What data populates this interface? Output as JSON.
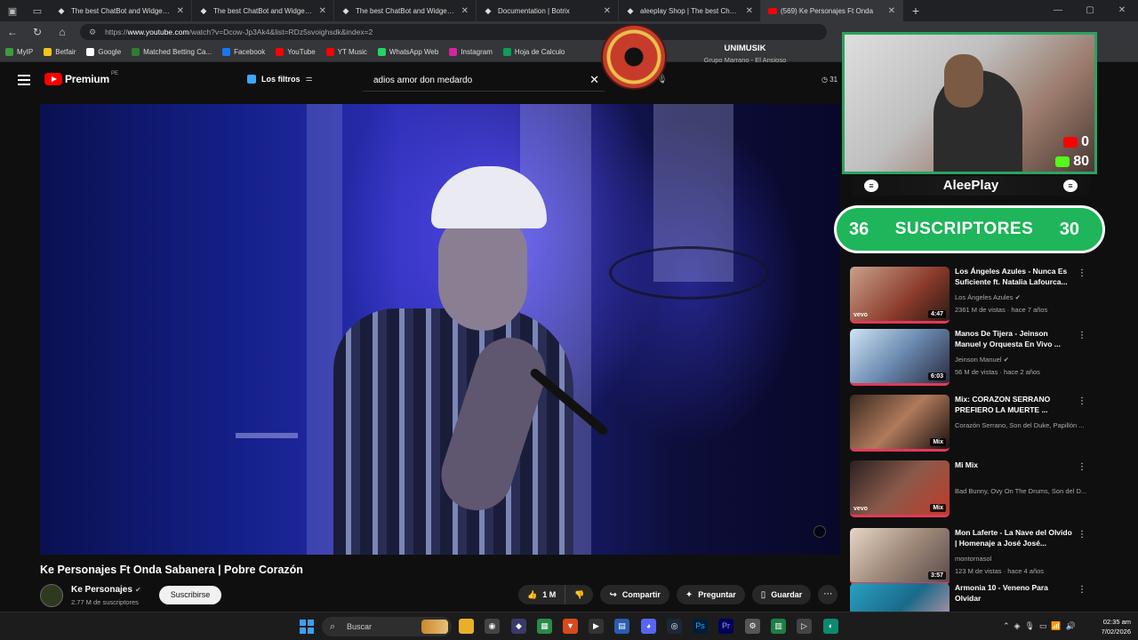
{
  "browser": {
    "tabs": [
      {
        "title": "The best ChatBot and Widgets fo",
        "icon": "botrix-icon"
      },
      {
        "title": "The best ChatBot and Widgets fo",
        "icon": "botrix-icon"
      },
      {
        "title": "The best ChatBot and Widgets fo",
        "icon": "botrix-icon"
      },
      {
        "title": "Documentation | Botrix",
        "icon": "botrix-icon"
      },
      {
        "title": "aleeplay Shop | The best ChatBot",
        "icon": "botrix-icon"
      },
      {
        "title": "(569) Ke Personajes Ft Onda",
        "icon": "youtube-icon"
      }
    ],
    "url_prefix": "https://",
    "url_host": "www.youtube.com",
    "url_path": "/watch?v=Dcow-Jp3Ak4&list=RDz5svoighsdk&index=2",
    "bookmarks": [
      {
        "label": "MyIP",
        "color": "#3c9b3c"
      },
      {
        "label": "Betfair",
        "color": "#f5c518"
      },
      {
        "label": "Google",
        "color": "#ffffff"
      },
      {
        "label": "Matched Betting Ca...",
        "color": "#2e7d32"
      },
      {
        "label": "Facebook",
        "color": "#1877f2"
      },
      {
        "label": "YouTube",
        "color": "#ff0000"
      },
      {
        "label": "YT Music",
        "color": "#ff0000"
      },
      {
        "label": "WhatsApp Web",
        "color": "#25d366"
      },
      {
        "label": "Instagram",
        "color": "#d6249f"
      },
      {
        "label": "Hoja de Calculo",
        "color": "#0f9d58"
      }
    ]
  },
  "youtube": {
    "logo_text": "Premium",
    "country": "PE",
    "filters_label": "Los filtros",
    "search_value": "adios amor don medardo",
    "header_right": "31"
  },
  "overlay": {
    "now_playing_artist": "UNIMUSIK",
    "now_playing_song": "Grupo Marrano - El Ansioso",
    "youtube_count": "0",
    "kick_count": "80",
    "streamer_name": "AleePlay",
    "subs_current": "36",
    "subs_label": "SUSCRIPTORES",
    "subs_goal": "30",
    "colors": {
      "accent_green": "#1fb55a",
      "yt_red": "#ff0000",
      "kick_green": "#53fc18"
    }
  },
  "video": {
    "title": "Ke Personajes Ft Onda Sabanera | Pobre Corazón",
    "channel": "Ke Personajes",
    "subscribers": "2.77 M de suscriptores",
    "subscribe_label": "Suscribirse",
    "likes": "1 M",
    "share_label": "Compartir",
    "ask_label": "Preguntar",
    "save_label": "Guardar"
  },
  "recommendations": [
    {
      "title": "Los Ángeles Azules - Nunca Es Suficiente ft. Natalia Lafourca...",
      "channel": "Los Ángeles Azules",
      "verified": true,
      "meta": "2361 M de vistas · hace 7 años",
      "duration": "4:47",
      "badge": "vevo"
    },
    {
      "title": "Manos De Tijera - Jeinson Manuel y Orquesta En Vivo ...",
      "channel": "Jeinson Manuel",
      "verified": true,
      "meta": "56 M de vistas · hace 2 años",
      "duration": "6:03",
      "badge": ""
    },
    {
      "title": "Mix: CORAZON SERRANO PREFIERO LA MUERTE ...",
      "channel": "Corazón Serrano, Son del Duke, Papillón ...",
      "verified": false,
      "meta": "",
      "duration": "Mix",
      "badge": ""
    },
    {
      "title": "Mi Mix",
      "channel": "Bad Bunny, Ovy On The Drums, Son del D...",
      "verified": false,
      "meta": "",
      "duration": "Mix",
      "badge": "vevo"
    },
    {
      "title": "Mon Laferte - La Nave del Olvido | Homenaje a José José...",
      "channel": "montornasol",
      "verified": false,
      "meta": "123 M de vistas · hace 4 años",
      "duration": "3:57",
      "badge": ""
    },
    {
      "title": "Armonia 10 - Veneno Para Olvidar",
      "channel": "",
      "verified": false,
      "meta": "",
      "duration": "",
      "badge": ""
    }
  ],
  "taskbar": {
    "search_placeholder": "Buscar",
    "time": "02:35 am",
    "date": "7/02/2026"
  }
}
